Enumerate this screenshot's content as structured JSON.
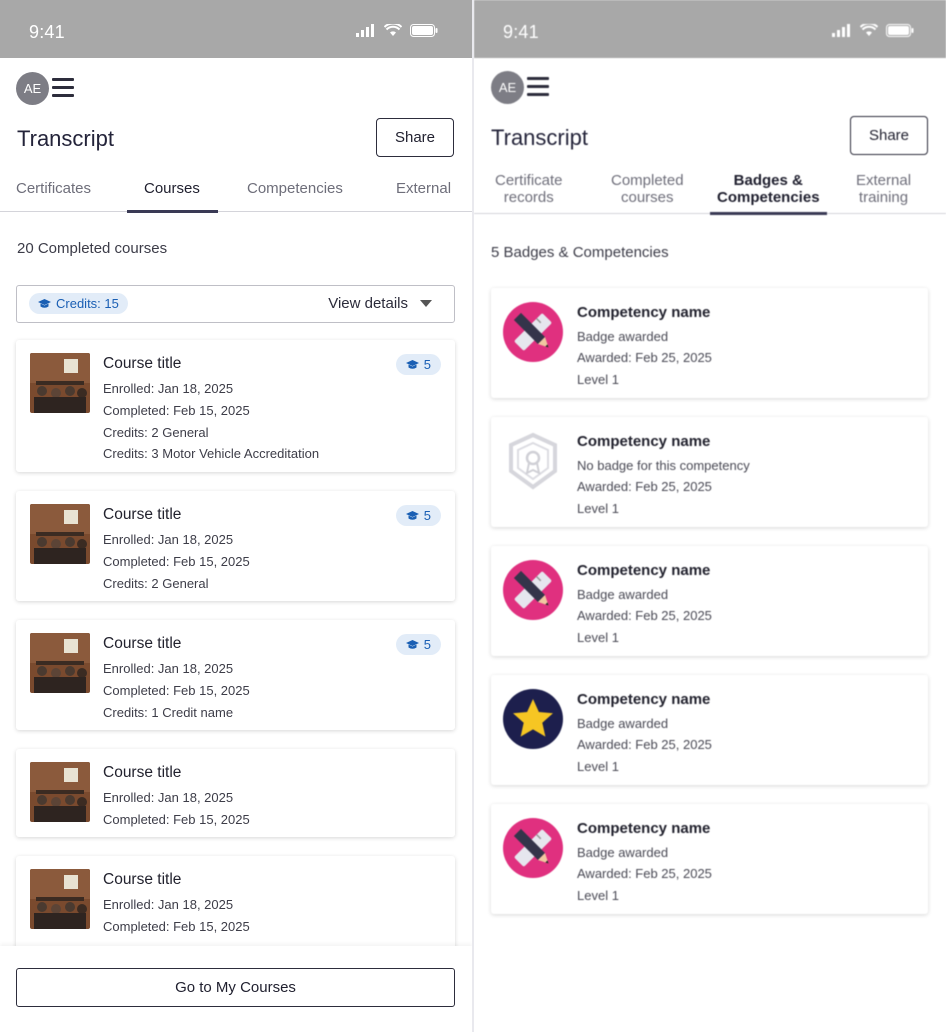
{
  "status_bar": {
    "time": "9:41"
  },
  "left": {
    "avatar_initials": "AE",
    "title": "Transcript",
    "share_label": "Share",
    "tabs": [
      {
        "label": "Certificates",
        "active": false
      },
      {
        "label": "Courses",
        "active": true
      },
      {
        "label": "Competencies",
        "active": false
      },
      {
        "label": "External",
        "active": false
      }
    ],
    "count_text": "20 Completed courses",
    "credits_chip": "Credits: 15",
    "view_details": "View details",
    "courses": [
      {
        "title": "Course title",
        "lines": [
          "Enrolled: Jan 18, 2025",
          "Completed: Feb 15, 2025",
          "Credits: 2 General",
          "Credits: 3 Motor Vehicle Accreditation"
        ],
        "badge": "5"
      },
      {
        "title": "Course title",
        "lines": [
          "Enrolled: Jan 18, 2025",
          "Completed: Feb 15, 2025",
          "Credits: 2 General"
        ],
        "badge": "5"
      },
      {
        "title": "Course title",
        "lines": [
          "Enrolled: Jan 18, 2025",
          "Completed: Feb 15, 2025",
          "Credits: 1 Credit name"
        ],
        "badge": "5"
      },
      {
        "title": "Course title",
        "lines": [
          "Enrolled: Jan 18, 2025",
          "Completed: Feb 15, 2025"
        ]
      },
      {
        "title": "Course title",
        "lines": [
          "Enrolled: Jan 18, 2025",
          "Completed: Feb 15, 2025"
        ]
      }
    ],
    "go_button": "Go to My Courses"
  },
  "right": {
    "avatar_initials": "AE",
    "title": "Transcript",
    "share_label": "Share",
    "tabs": [
      {
        "line1": "Certificate",
        "line2": "records",
        "active": false
      },
      {
        "line1": "Completed",
        "line2": "courses",
        "active": false
      },
      {
        "line1": "Badges &",
        "line2": "Competencies",
        "active": true
      },
      {
        "line1": "External",
        "line2": "training",
        "active": false
      }
    ],
    "count_text": "5 Badges & Competencies",
    "competencies": [
      {
        "title": "Competency name",
        "status": "Badge awarded",
        "awarded": "Awarded: Feb 25, 2025",
        "level": "Level 1",
        "badge_icon": "pencil-ruler-badge-icon"
      },
      {
        "title": "Competency name",
        "status": "No badge for this competency",
        "awarded": "Awarded: Feb 25, 2025",
        "level": "Level 1",
        "badge_icon": "empty-shield-badge-icon"
      },
      {
        "title": "Competency name",
        "status": "Badge awarded",
        "awarded": "Awarded: Feb 25, 2025",
        "level": "Level 1",
        "badge_icon": "pencil-ruler-badge-icon"
      },
      {
        "title": "Competency name",
        "status": "Badge awarded",
        "awarded": "Awarded: Feb 25, 2025",
        "level": "Level 1",
        "badge_icon": "star-badge-icon"
      },
      {
        "title": "Competency name",
        "status": "Badge awarded",
        "awarded": "Awarded: Feb 25, 2025",
        "level": "Level 1",
        "badge_icon": "pencil-ruler-badge-icon"
      }
    ]
  },
  "colors": {
    "status_bar": "#a8a8a8",
    "chip_bg": "#e2ecf8",
    "chip_text": "#1a5fb4",
    "badge_pink": "#e0307f",
    "badge_navy": "#1d1f4d",
    "star_yellow": "#f6c623"
  }
}
